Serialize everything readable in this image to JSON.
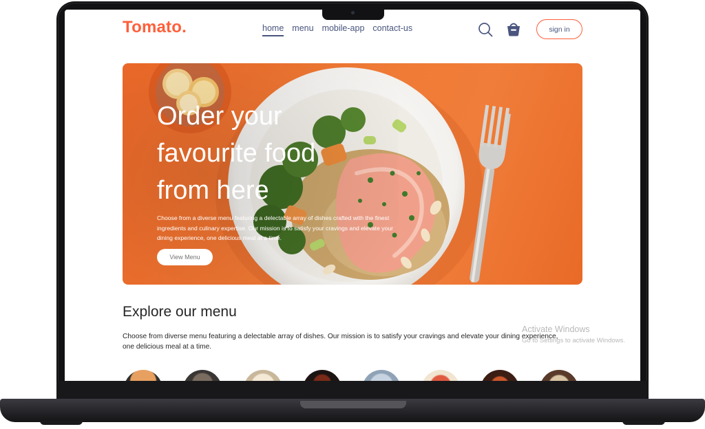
{
  "brand": {
    "logo": "Tomato."
  },
  "nav": {
    "items": [
      "home",
      "menu",
      "mobile-app",
      "contact-us"
    ],
    "active": "home"
  },
  "header": {
    "search_icon": "search-icon",
    "basket_icon": "basket-icon",
    "signin_label": "sign in"
  },
  "hero": {
    "title": "Order your favourite food from here",
    "description": "Choose from a diverse menu featuring a delectable array of dishes crafted with the finest ingredients and culinary expertise. Our mission is to satisfy your cravings and elevate your dining experience, one delicious meal at a time.",
    "button_label": "View Menu"
  },
  "explore": {
    "title": "Explore our menu",
    "description": "Choose from diverse menu featuring a delectable array of dishes. Our mission is to satisfy your cravings and elevate your dining experience, one delicious meal at a time.",
    "items": [
      "menu-item-1",
      "menu-item-2",
      "menu-item-3",
      "menu-item-4",
      "menu-item-5",
      "menu-item-6",
      "menu-item-7",
      "menu-item-8"
    ]
  },
  "watermark": {
    "line1": "Activate Windows",
    "line2": "Go to Settings to activate Windows."
  },
  "colors": {
    "accent": "#ff5f3a",
    "nav_text": "#49557e",
    "hero_orange": "#f07a33",
    "heading": "#262626"
  }
}
